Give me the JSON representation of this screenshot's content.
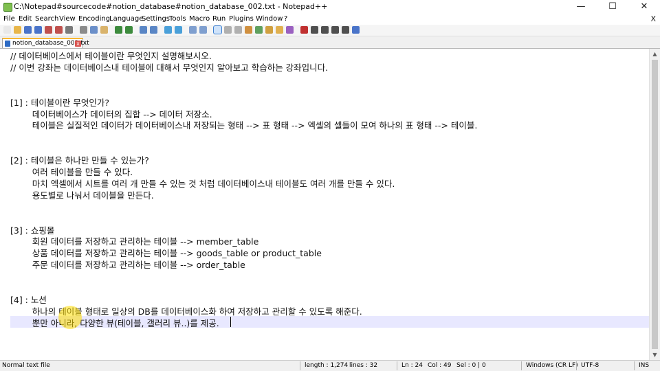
{
  "window": {
    "title": "C:\\Notepad#sourcecode#notion_database#notion_database_002.txt - Notepad++",
    "minimize_glyph": "—",
    "maximize_glyph": "☐",
    "close_glyph": "✕"
  },
  "menu": {
    "items": [
      "File",
      "Edit",
      "Search",
      "View",
      "Encoding",
      "Language",
      "Settings",
      "Tools",
      "Macro",
      "Run",
      "Plugins",
      "Window",
      "?"
    ],
    "close_glyph": "X"
  },
  "tab": {
    "label": "notion_database_002.txt",
    "close_glyph": "x"
  },
  "editor": {
    "lines": [
      "// 데이터베이스에서 테이블이란 무엇인지 설명해보시오.",
      "// 이번 강좌는 데이터베이스내 테이블에 대해서 무엇인지 알아보고 학습하는 강좌입니다.",
      "",
      "",
      "[1] : 테이블이란 무엇인가?",
      "        데이터베이스가 데이터의 집합 --> 데이터 저장소.",
      "        테이블은 실질적인 데이터가 데이터베이스내 저장되는 형태 --> 표 형태 --> 엑셀의 셀들이 모여 하나의 표 형태 --> 테이블.",
      "",
      "",
      "[2] : 테이블은 하나만 만들 수 있는가?",
      "        여러 테이블을 만들 수 있다.",
      "        마치 엑셀에서 시트를 여러 개 만들 수 있는 것 처럼 데이터베이스내 테이블도 여러 개를 만들 수 있다.",
      "        용도별로 나눠서 데이블을 만든다.",
      "",
      "",
      "[3] : 쇼핑몰",
      "        회원 데이터를 저장하고 관리하는 테이블 --> member_table",
      "        상품 데이터를 저장하고 관리하는 테이블 --> goods_table or product_table",
      "        주문 데이터를 저장하고 관리하는 테이블 --> order_table",
      "",
      "",
      "[4] : 노션",
      "        하나의 테이블 형태로 일상의 DB를 데이터베이스화 하여 저장하고 관리할 수 있도록 해준다.",
      "        뿐만 아니라, 다양한 뷰(테이블, 갤러리 뷰..)를 제공."
    ]
  },
  "scrollbar": {
    "up_glyph": "▲",
    "down_glyph": "▼"
  },
  "status": {
    "file_type": "Normal text file",
    "length": "length : 1,274",
    "lines": "lines : 32",
    "ln": "Ln : 24",
    "col": "Col : 49",
    "sel": "Sel : 0 | 0",
    "eol": "Windows (CR LF)",
    "encoding": "UTF-8",
    "mode": "INS"
  },
  "toolbar": {
    "icons": [
      "new-file",
      "open-file",
      "save",
      "save-all",
      "close",
      "close-all",
      "print",
      "cut",
      "copy",
      "paste",
      "undo",
      "redo",
      "find",
      "replace",
      "zoom-in",
      "zoom-out",
      "sync-vertical",
      "sync-horizontal",
      "word-wrap",
      "show-all-chars",
      "indent-guide",
      "user-language",
      "document-map",
      "function-list",
      "folder-workspace",
      "monitoring",
      "record-macro",
      "stop-macro",
      "play-macro",
      "run-macro-multiple",
      "save-macro",
      "launch"
    ],
    "colors": [
      "#e8e8e8",
      "#e8b64a",
      "#4a74c9",
      "#4a74c9",
      "#c0504d",
      "#c0504d",
      "#7a7a7a",
      "#8a8a8a",
      "#6b8fc9",
      "#d9b36b",
      "#3d8b3d",
      "#3d8b3d",
      "#5a86c5",
      "#5a86c5",
      "#4aa0d9",
      "#4aa0d9",
      "#7f9fcf",
      "#7f9fcf",
      "#3c7fd0",
      "#b0b0b0",
      "#b0b0b0",
      "#d09040",
      "#5fa05f",
      "#d0a040",
      "#e0b050",
      "#9a60c0",
      "#c03030",
      "#505050",
      "#505050",
      "#505050",
      "#505050",
      "#4a74c9"
    ],
    "active_index": 18
  }
}
